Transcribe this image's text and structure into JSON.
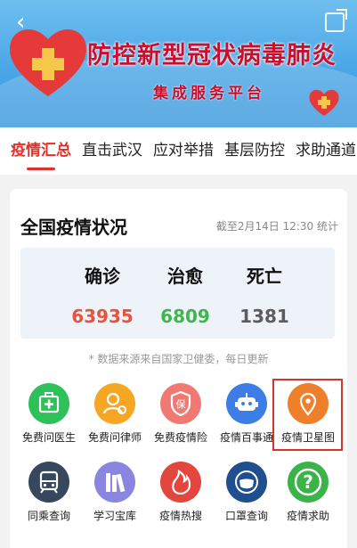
{
  "banner": {
    "title": "防控新型冠状病毒肺炎",
    "subtitle": "集成服务平台"
  },
  "tabs": [
    "疫情汇总",
    "直击武汉",
    "应对举措",
    "基层防控",
    "求助通道"
  ],
  "summary": {
    "title": "全国疫情状况",
    "update_time": "截至2月14日 12:30 统计",
    "stats": [
      {
        "label": "确诊",
        "value": "63935",
        "color": "#e8533f"
      },
      {
        "label": "治愈",
        "value": "6809",
        "color": "#3cb84b"
      },
      {
        "label": "死亡",
        "value": "1381",
        "color": "#5c5c5c"
      }
    ],
    "note": "* 数据来源来自国家卫健委，每日更新"
  },
  "services": [
    {
      "label": "免费问医生",
      "icon": "medical-kit-icon",
      "color": "#2ec15a"
    },
    {
      "label": "免费问律师",
      "icon": "lawyer-icon",
      "color": "#f5a623"
    },
    {
      "label": "免费疫情险",
      "icon": "insurance-shield-icon",
      "color": "#f07a73"
    },
    {
      "label": "疫情百事通",
      "icon": "robot-icon",
      "color": "#3d7ee6"
    },
    {
      "label": "疫情卫星图",
      "icon": "map-pin-icon",
      "color": "#f07f2c"
    },
    {
      "label": "同乘查询",
      "icon": "train-icon",
      "color": "#37475e"
    },
    {
      "label": "学习宝库",
      "icon": "books-icon",
      "color": "#8a86e0"
    },
    {
      "label": "疫情热搜",
      "icon": "flame-icon",
      "color": "#e2463c"
    },
    {
      "label": "口罩查询",
      "icon": "mask-icon",
      "color": "#1f4f8f"
    },
    {
      "label": "疫情求助",
      "icon": "help-icon",
      "color": "#3bb349"
    }
  ]
}
